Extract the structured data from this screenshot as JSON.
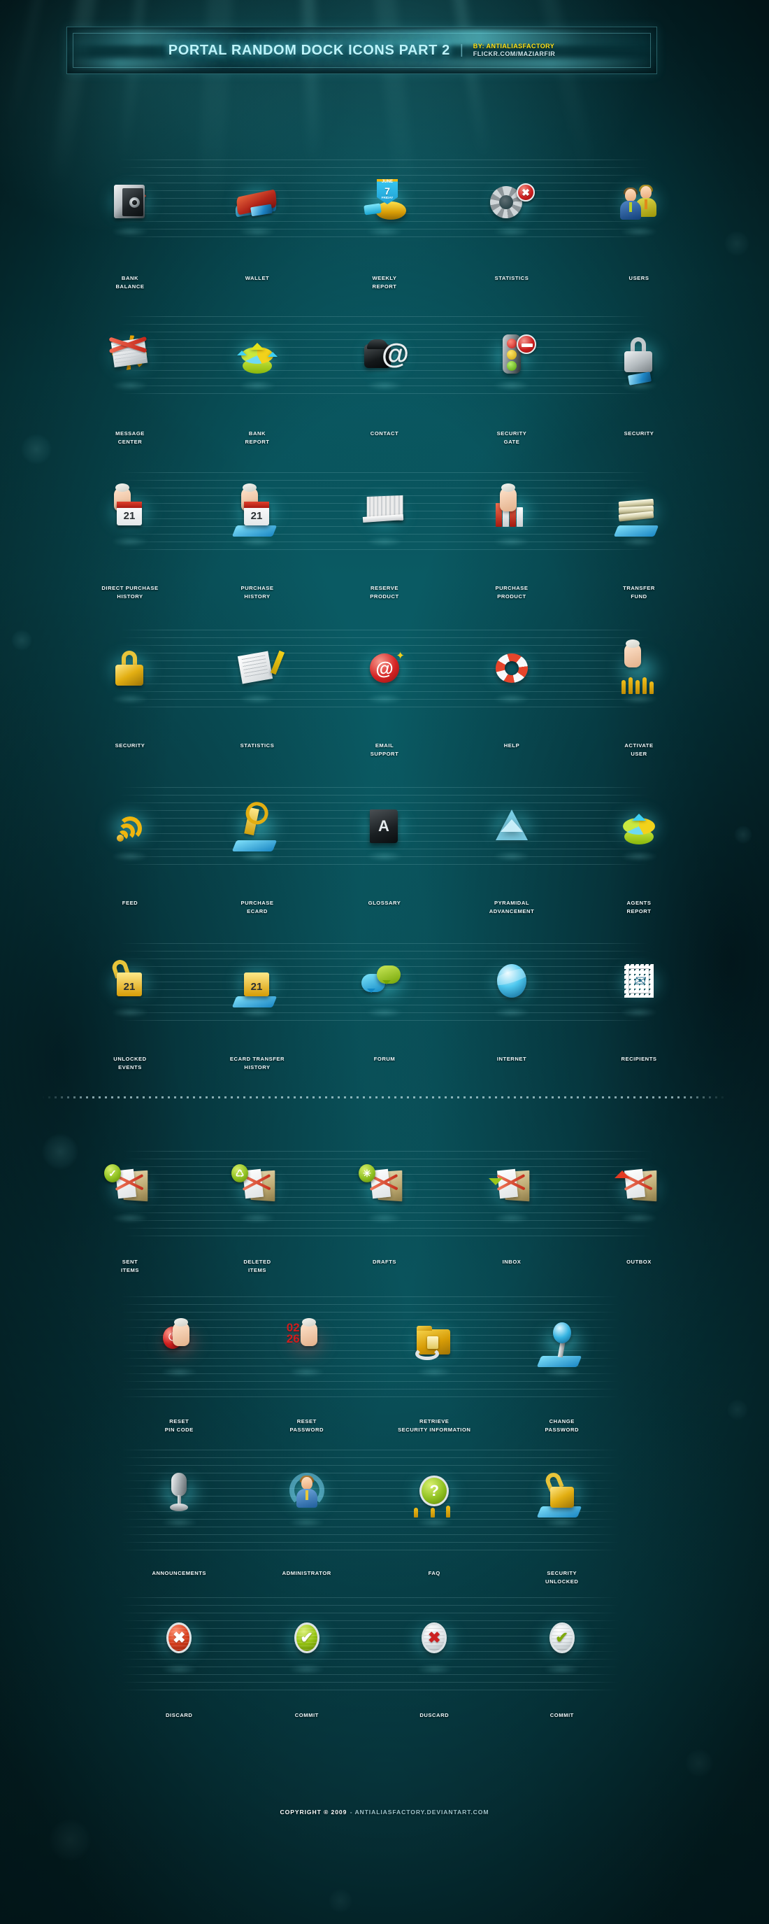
{
  "header": {
    "title": "PORTAL RANDOM DOCK ICONS PART 2",
    "separator": "|",
    "by": "BY: ANTIALIASFACTORY",
    "link": "FLICKR.COM/MAZIARFIR"
  },
  "sections": [
    {
      "id": "main-grid",
      "rows": [
        {
          "items": [
            {
              "label": "BANK\nBALANCE",
              "icon": "safe-icon"
            },
            {
              "label": "WALLET",
              "icon": "wallet-icon"
            },
            {
              "label": "WEEKLY\nREPORT",
              "icon": "calendar-disc-icon",
              "month": "JUNE",
              "day": "7",
              "weekday": "FRIDAY"
            },
            {
              "label": "STATISTICS",
              "icon": "gear-error-icon",
              "badge": "✖"
            },
            {
              "label": "USERS",
              "icon": "users-icon"
            }
          ]
        },
        {
          "items": [
            {
              "label": "MESSAGE\nCENTER",
              "icon": "envelope-cancel-icon"
            },
            {
              "label": "BANK\nREPORT",
              "icon": "pie-chart-icon"
            },
            {
              "label": "CONTACT",
              "icon": "phone-at-icon",
              "glyph": "@"
            },
            {
              "label": "SECURITY\nGATE",
              "icon": "traffic-light-icon"
            },
            {
              "label": "SECURITY",
              "icon": "padlock-silver-icon"
            }
          ]
        },
        {
          "items": [
            {
              "label": "DIRECT PURCHASE\nHISTORY",
              "icon": "hand-calendar-icon",
              "day": "21"
            },
            {
              "label": "PURCHASE\nHISTORY",
              "icon": "hand-calendar-card-icon",
              "day": "21"
            },
            {
              "label": "RESERVE\nPRODUCT",
              "icon": "shelf-ruler-icon"
            },
            {
              "label": "PURCHASE\nPRODUCT",
              "icon": "hand-books-icon"
            },
            {
              "label": "TRANSFER\nFUND",
              "icon": "money-stack-icon"
            }
          ]
        },
        {
          "items": [
            {
              "label": "SECURITY",
              "icon": "padlock-gold-icon"
            },
            {
              "label": "STATISTICS",
              "icon": "document-pencil-icon"
            },
            {
              "label": "EMAIL\nSUPPORT",
              "icon": "at-badge-icon",
              "glyph": "@"
            },
            {
              "label": "HELP",
              "icon": "lifebuoy-icon"
            },
            {
              "label": "ACTIVATE\nUSER",
              "icon": "hand-people-icon"
            }
          ]
        },
        {
          "items": [
            {
              "label": "FEED",
              "icon": "rss-icon"
            },
            {
              "label": "PURCHASE\nECARD",
              "icon": "key-card-icon"
            },
            {
              "label": "GLOSSARY",
              "icon": "address-book-icon",
              "glyph": "A"
            },
            {
              "label": "PYRAMIDAL\nADVANCEMENT",
              "icon": "pyramid-icon"
            },
            {
              "label": "AGENTS\nREPORT",
              "icon": "agents-chart-icon"
            }
          ]
        },
        {
          "items": [
            {
              "label": "UNLOCKED\nEVENTS",
              "icon": "unlocked-calendar-icon",
              "day": "21"
            },
            {
              "label": "ECARD TRANSFER\nHISTORY",
              "icon": "calendar-card-icon",
              "day": "21"
            },
            {
              "label": "FORUM",
              "icon": "chat-bubbles-icon"
            },
            {
              "label": "INTERNET",
              "icon": "globe-icon"
            },
            {
              "label": "RECIPIENTS",
              "icon": "stamp-icon"
            }
          ]
        }
      ]
    },
    {
      "id": "mail-grid",
      "rows": [
        {
          "items": [
            {
              "label": "SENT\nITEMS",
              "icon": "folder-check-icon",
              "badge": "✓"
            },
            {
              "label": "DELETED\nITEMS",
              "icon": "folder-recycle-icon",
              "badge": "♺"
            },
            {
              "label": "DRAFTS",
              "icon": "folder-draft-icon",
              "badge": "✳"
            },
            {
              "label": "INBOX",
              "icon": "folder-inbox-icon"
            },
            {
              "label": "OUTBOX",
              "icon": "folder-outbox-icon"
            }
          ]
        }
      ]
    },
    {
      "id": "account-grid",
      "rows": [
        {
          "items": [
            {
              "label": "RESET\nPIN CODE",
              "icon": "hand-power-icon",
              "glyph": "⏻"
            },
            {
              "label": "RESET\nPASSWORD",
              "icon": "hand-digits-icon",
              "digits": "02\n26"
            },
            {
              "label": "RETRIEVE\nSECURITY INFORMATION",
              "icon": "folder-lock-refresh-icon"
            },
            {
              "label": "CHANGE\nPASSWORD",
              "icon": "pin-card-icon"
            }
          ]
        }
      ]
    },
    {
      "id": "admin-grid",
      "rows": [
        {
          "items": [
            {
              "label": "ANNOUNCEMENTS",
              "icon": "microphone-icon"
            },
            {
              "label": "ADMINISTRATOR",
              "icon": "admin-user-icon"
            },
            {
              "label": "FAQ",
              "icon": "question-people-icon",
              "glyph": "?"
            },
            {
              "label": "SECURITY\nUNLOCKED",
              "icon": "unlocked-card-icon"
            }
          ]
        }
      ]
    },
    {
      "id": "action-grid",
      "rows": [
        {
          "items": [
            {
              "label": "DISCARD",
              "icon": "cross-red-button-icon",
              "glyph": "✖"
            },
            {
              "label": "COMMIT",
              "icon": "check-green-button-icon",
              "glyph": "✔"
            },
            {
              "label": "DUSCARD",
              "icon": "cross-white-button-icon",
              "glyph": "✖"
            },
            {
              "label": "COMMIT",
              "icon": "check-white-button-icon",
              "glyph": "✔"
            }
          ]
        }
      ]
    }
  ],
  "footer": {
    "copyright": "COPYRIGHT ® 2009",
    "site": "- ANTIALIASFACTORY.DEVIANTART.COM"
  },
  "colors": {
    "accent_cyan": "#7de9fb",
    "highlight_yellow": "#ffe41a",
    "bg_teal": "#0a5a63",
    "label_text": "#f2fbfd"
  }
}
